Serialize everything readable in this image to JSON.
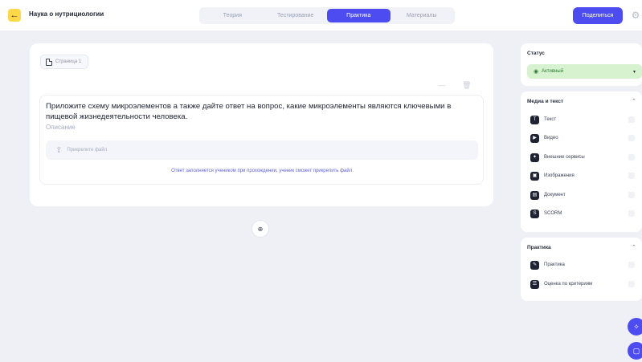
{
  "header": {
    "course_title": "Наука о нутрициологии",
    "tabs": [
      {
        "label": "Теория",
        "active": false
      },
      {
        "label": "Тестирование",
        "active": false
      },
      {
        "label": "Практика",
        "active": true
      },
      {
        "label": "Материалы",
        "active": false
      }
    ],
    "share_label": "Поделиться",
    "accent_color": "#4c4cf0",
    "back_color": "#ffd84a"
  },
  "page_chip": {
    "label": "Страница 1"
  },
  "task": {
    "question": "Приложите схему микроэлементов а также дайте ответ на вопрос, какие микроэлементы являются ключевыми в пищевой жизнедеятельности человека.",
    "description_placeholder": "Описание",
    "attach_label": "Прикрепите файл",
    "hint": "Ответ заполняется учеником при прохождении, ученик сможет прикрепить файл."
  },
  "status_panel": {
    "title": "Статус",
    "value": "Активный",
    "color": "#d6f2cf"
  },
  "media_panel": {
    "title": "Медиа и текст",
    "items": [
      {
        "label": "Текст",
        "icon": "text-icon"
      },
      {
        "label": "Видео",
        "icon": "video-icon"
      },
      {
        "label": "Внешние сервисы",
        "icon": "external-services-icon"
      },
      {
        "label": "Изображения",
        "icon": "image-icon"
      },
      {
        "label": "Документ",
        "icon": "document-icon"
      },
      {
        "label": "SCORM",
        "icon": "scorm-icon"
      }
    ]
  },
  "practice_panel": {
    "title": "Практика",
    "items": [
      {
        "label": "Практика",
        "icon": "practice-icon"
      },
      {
        "label": "Оценка по критериям",
        "icon": "criteria-icon"
      }
    ]
  }
}
